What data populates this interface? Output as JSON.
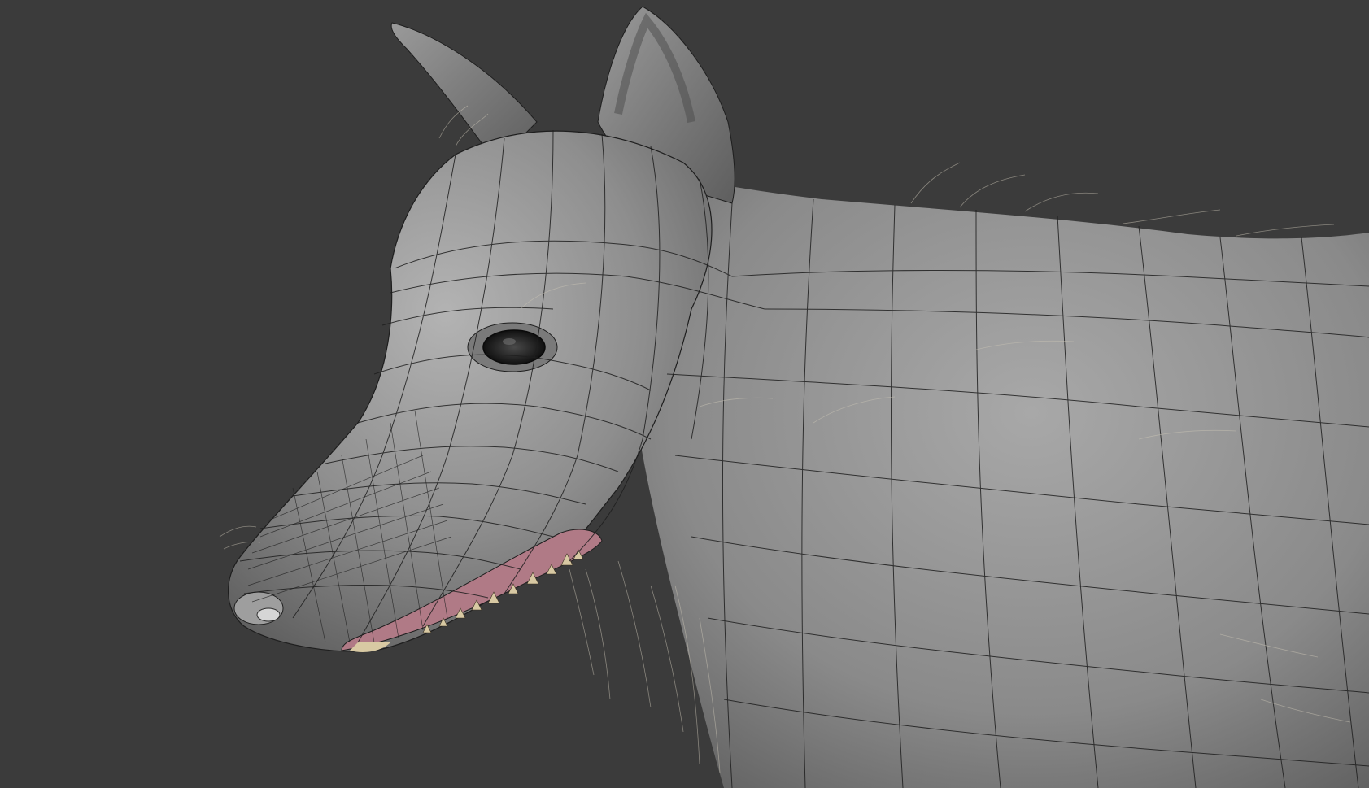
{
  "viewport": {
    "background_color": "#3b3b3b",
    "subject": "wolf-head-wireframe",
    "body_color": "#8f8f8f",
    "wire_color": "#1e1e1e",
    "hair_color": "#c9c3b4",
    "gum_color": "#b07a86",
    "teeth_color": "#d8c9a3"
  }
}
